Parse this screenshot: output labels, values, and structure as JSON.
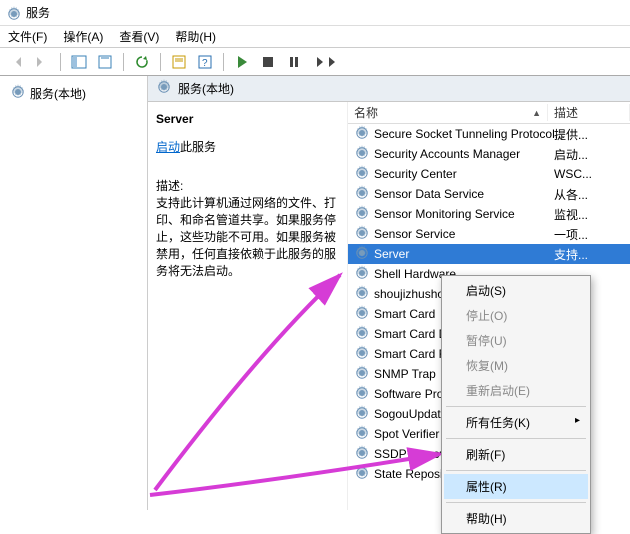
{
  "window": {
    "title": "服务"
  },
  "menus": {
    "file": "文件(F)",
    "action": "操作(A)",
    "view": "查看(V)",
    "help": "帮助(H)"
  },
  "tree": {
    "root": "服务(本地)"
  },
  "right_header": "服务(本地)",
  "columns": {
    "name": "名称",
    "desc": "描述"
  },
  "detail": {
    "title": "Server",
    "start_word": "启动",
    "start_suffix": "此服务",
    "desc_label": "描述:",
    "desc": "支持此计算机通过网络的文件、打印、和命名管道共享。如果服务停止，这些功能不可用。如果服务被禁用，任何直接依赖于此服务的服务将无法启动。"
  },
  "services": [
    {
      "name": "Secure Socket Tunneling Protocol...",
      "desc": "提供..."
    },
    {
      "name": "Security Accounts Manager",
      "desc": "启动..."
    },
    {
      "name": "Security Center",
      "desc": "WSC..."
    },
    {
      "name": "Sensor Data Service",
      "desc": "从各..."
    },
    {
      "name": "Sensor Monitoring Service",
      "desc": "监视..."
    },
    {
      "name": "Sensor Service",
      "desc": "一项..."
    },
    {
      "name": "Server",
      "desc": "支持...",
      "selected": true
    },
    {
      "name": "Shell Hardware",
      "desc": "..."
    },
    {
      "name": "shoujizhushou",
      "desc": "..."
    },
    {
      "name": "Smart Card",
      "desc": "..."
    },
    {
      "name": "Smart Card D",
      "desc": "..."
    },
    {
      "name": "Smart Card R",
      "desc": "..."
    },
    {
      "name": "SNMP Trap",
      "desc": "..."
    },
    {
      "name": "Software Prot",
      "desc": "..."
    },
    {
      "name": "SogouUpdate",
      "desc": "..."
    },
    {
      "name": "Spot Verifier",
      "desc": "..."
    },
    {
      "name": "SSDP Discove",
      "desc": "..."
    },
    {
      "name": "State Repository Service",
      "desc": "..."
    }
  ],
  "context_menu": {
    "start": {
      "label": "启动(S)",
      "enabled": true
    },
    "stop": {
      "label": "停止(O)",
      "enabled": false
    },
    "pause": {
      "label": "暂停(U)",
      "enabled": false
    },
    "resume": {
      "label": "恢复(M)",
      "enabled": false
    },
    "restart": {
      "label": "重新启动(E)",
      "enabled": false
    },
    "alltasks": {
      "label": "所有任务(K)",
      "enabled": true,
      "submenu": true
    },
    "refresh": {
      "label": "刷新(F)",
      "enabled": true
    },
    "props": {
      "label": "属性(R)",
      "enabled": true,
      "highlight": true
    },
    "help": {
      "label": "帮助(H)",
      "enabled": true
    }
  },
  "arrows": {
    "color": "#d63cd6"
  }
}
